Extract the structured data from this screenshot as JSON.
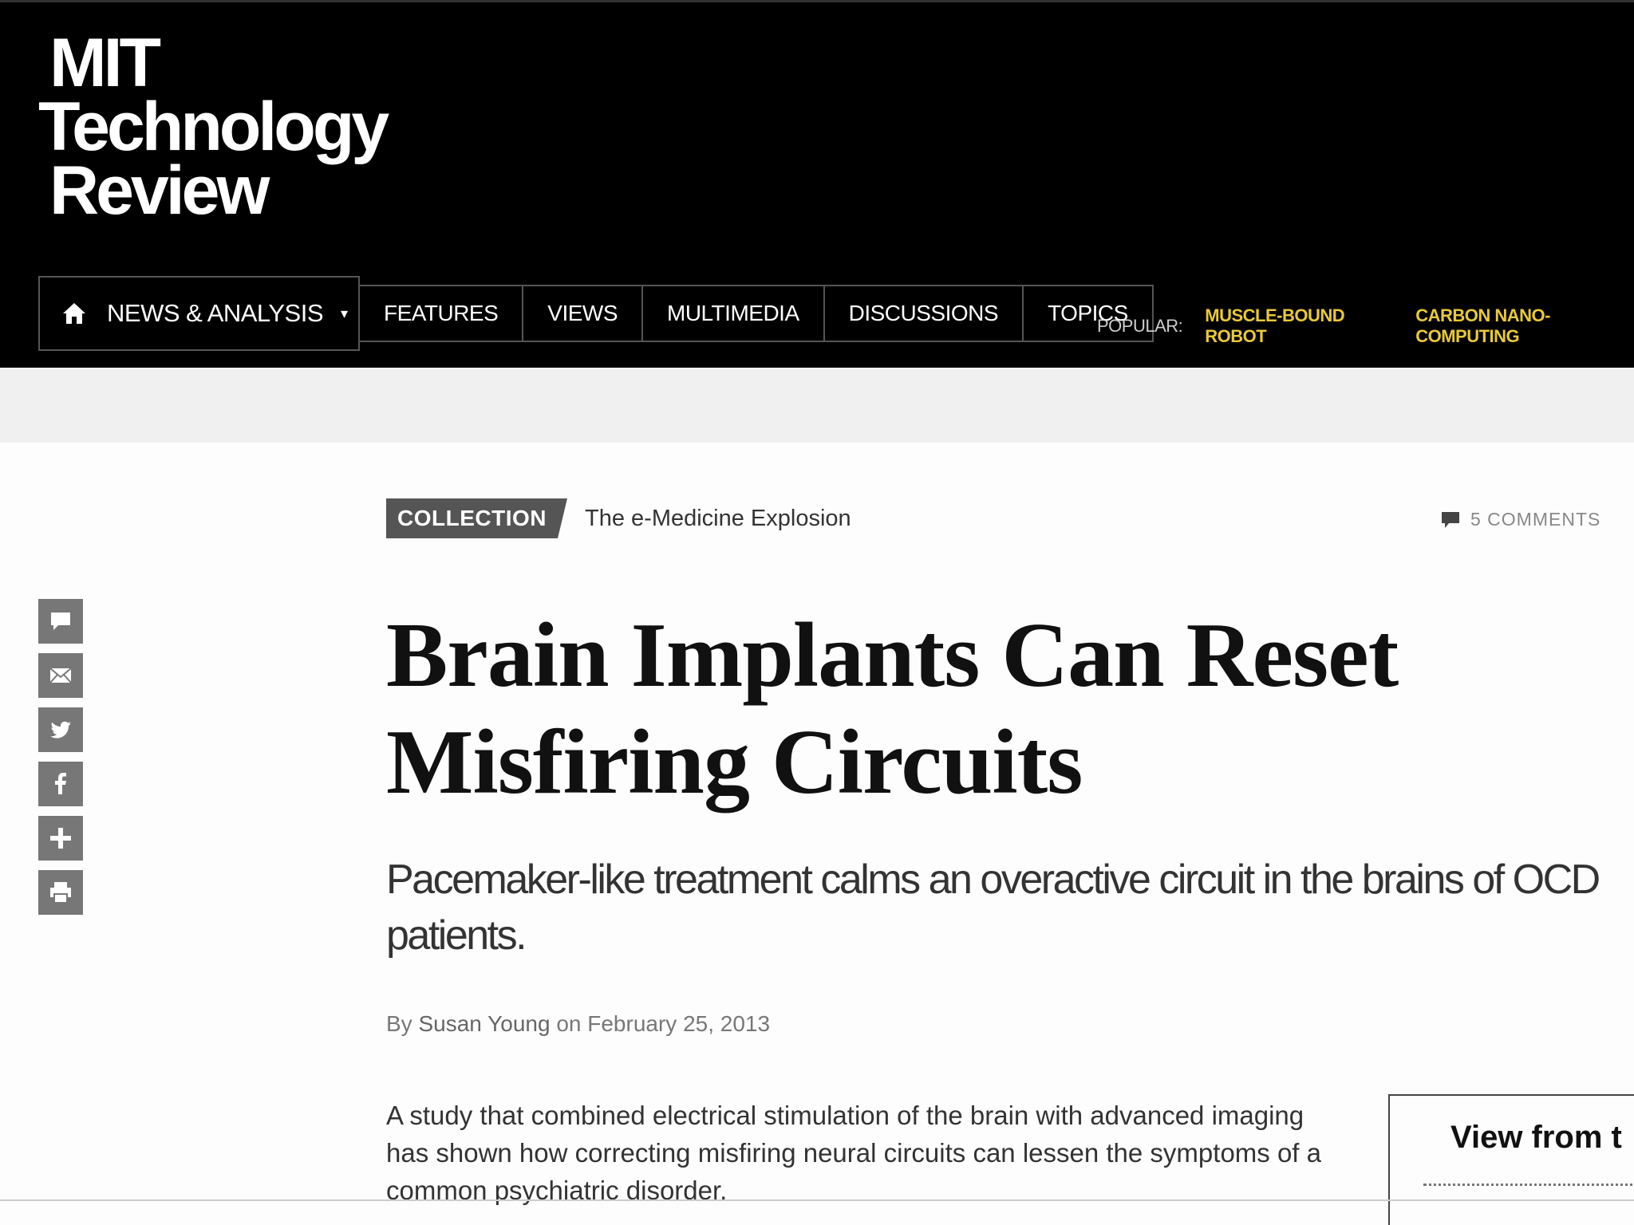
{
  "brand": {
    "line1": "MIT",
    "line2": "Technology",
    "line3": "Review"
  },
  "nav": {
    "main_label": "NEWS & ANALYSIS",
    "items": [
      "FEATURES",
      "VIEWS",
      "MULTIMEDIA",
      "DISCUSSIONS",
      "TOPICS"
    ]
  },
  "popular": {
    "label": "POPULAR:",
    "links": [
      "MUSCLE-BOUND ROBOT",
      "CARBON NANO-COMPUTING"
    ]
  },
  "colors": {
    "accent_link": "#e8c93a",
    "header_bg": "#000000",
    "tag_bg": "#555555"
  },
  "share_icons": [
    "comment-icon",
    "email-icon",
    "twitter-icon",
    "facebook-icon",
    "plus-icon",
    "print-icon"
  ],
  "article": {
    "tag": "COLLECTION",
    "collection": "The e-Medicine Explosion",
    "comments": "5 COMMENTS",
    "title_line1": "Brain Implants Can Reset",
    "title_line2": "Misfiring Circuits",
    "dek": "Pacemaker-like treatment calms an overactive circuit in the brains of OCD patients.",
    "byline_prefix": "By",
    "author": "Susan Young",
    "byline_on": "on",
    "date": "February 25, 2013",
    "body_line1": "A study that combined electrical stimulation of the brain with advanced imaging",
    "body_line2": "has shown how correcting misfiring neural circuits can lessen the symptoms of a",
    "body_line3": "common psychiatric disorder."
  },
  "sidebox": {
    "heading": "View from t"
  }
}
